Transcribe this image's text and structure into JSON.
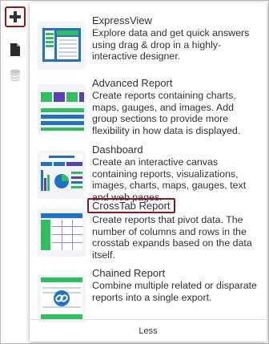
{
  "sidebar": {
    "add_button": "plus-icon",
    "document_button": "document-icon",
    "database_button": "database-icon"
  },
  "menu": {
    "items": [
      {
        "title": "ExpressView",
        "description": "Explore data and get quick answers using drag & drop in a highly-interactive designer."
      },
      {
        "title": "Advanced Report",
        "description": "Create reports containing charts, maps, gauges, and images. Add group sections to provide more flexibility in how data is displayed."
      },
      {
        "title": "Dashboard",
        "description": "Create an interactive canvas containing reports, visualizations, images, charts, maps, gauges, text and web pages."
      },
      {
        "title": "CrossTab Report",
        "description": "Create reports that pivot data. The number of columns and rows in the crosstab expands based on the data itself."
      },
      {
        "title": "Chained Report",
        "description": "Combine multiple related or disparate reports into a single export."
      }
    ],
    "less_label": "Less"
  },
  "colors": {
    "highlight_border": "#8b1a1a",
    "thumb_blue": "#1e73c8",
    "thumb_green": "#2fbf5f",
    "thumb_purple": "#5b3fb5"
  }
}
